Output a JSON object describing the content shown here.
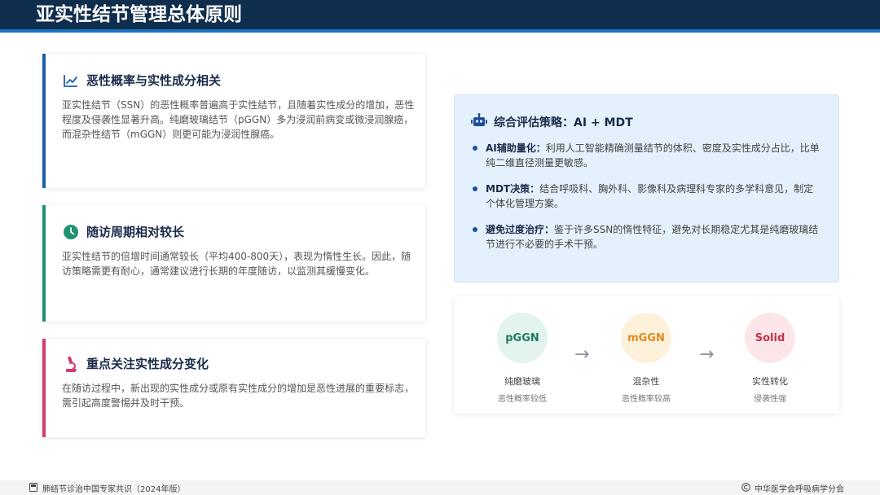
{
  "header": {
    "title": "亚实性结节管理总体原则"
  },
  "cards": [
    {
      "title": "恶性概率与实性成分相关",
      "icon": "trend-line-icon",
      "accent": "#1b5fa8",
      "body": "亚实性结节（SSN）的恶性概率普遍高于实性结节，且随着实性成分的增加，恶性程度及侵袭性显著升高。纯磨玻璃结节（pGGN）多为浸润前病变或微浸润腺癌，而混杂性结节（mGGN）则更可能为浸润性腺癌。"
    },
    {
      "title": "随访周期相对较长",
      "icon": "clock-icon",
      "accent": "#1f9273",
      "body": "亚实性结节的倍增时间通常较长（平均400-800天），表现为惰性生长。因此，随访策略需更有耐心，通常建议进行长期的年度随访，以监测其缓慢变化。"
    },
    {
      "title": "重点关注实性成分变化",
      "icon": "microscope-icon",
      "accent": "#d43a6e",
      "body": "在随访过程中，新出现的实性成分或原有实性成分的增加是恶性进展的重要标志，需引起高度警惕并及时干预。"
    }
  ],
  "strategy": {
    "title": "综合评估策略：AI + MDT",
    "icon": "robot-icon",
    "items": [
      {
        "label": "AI辅助量化：",
        "text": "利用人工智能精确测量结节的体积、密度及实性成分占比，比单纯二维直径测量更敏感。"
      },
      {
        "label": "MDT决策：",
        "text": "结合呼吸科、胸外科、影像科及病理科专家的多学科意见，制定个体化管理方案。"
      },
      {
        "label": "避免过度治疗：",
        "text": "鉴于许多SSN的惰性特征，避免对长期稳定尤其是纯磨玻璃结节进行不必要的手术干预。"
      }
    ]
  },
  "flow": {
    "nodes": [
      {
        "abbr": "pGGN",
        "label": "纯磨玻璃",
        "sub": "恶性概率较低",
        "bg": "#e3f3ee",
        "fg": "#1f7a63"
      },
      {
        "abbr": "mGGN",
        "label": "混杂性",
        "sub": "恶性概率较高",
        "bg": "#fdf1dc",
        "fg": "#e08a1c"
      },
      {
        "abbr": "Solid",
        "label": "实性转化",
        "sub": "侵袭性强",
        "bg": "#fde6ea",
        "fg": "#c73045"
      }
    ],
    "arrow": "→"
  },
  "footer": {
    "left": "肺结节诊治中国专家共识（2024年版）",
    "right": "中华医学会呼吸病学分会"
  }
}
